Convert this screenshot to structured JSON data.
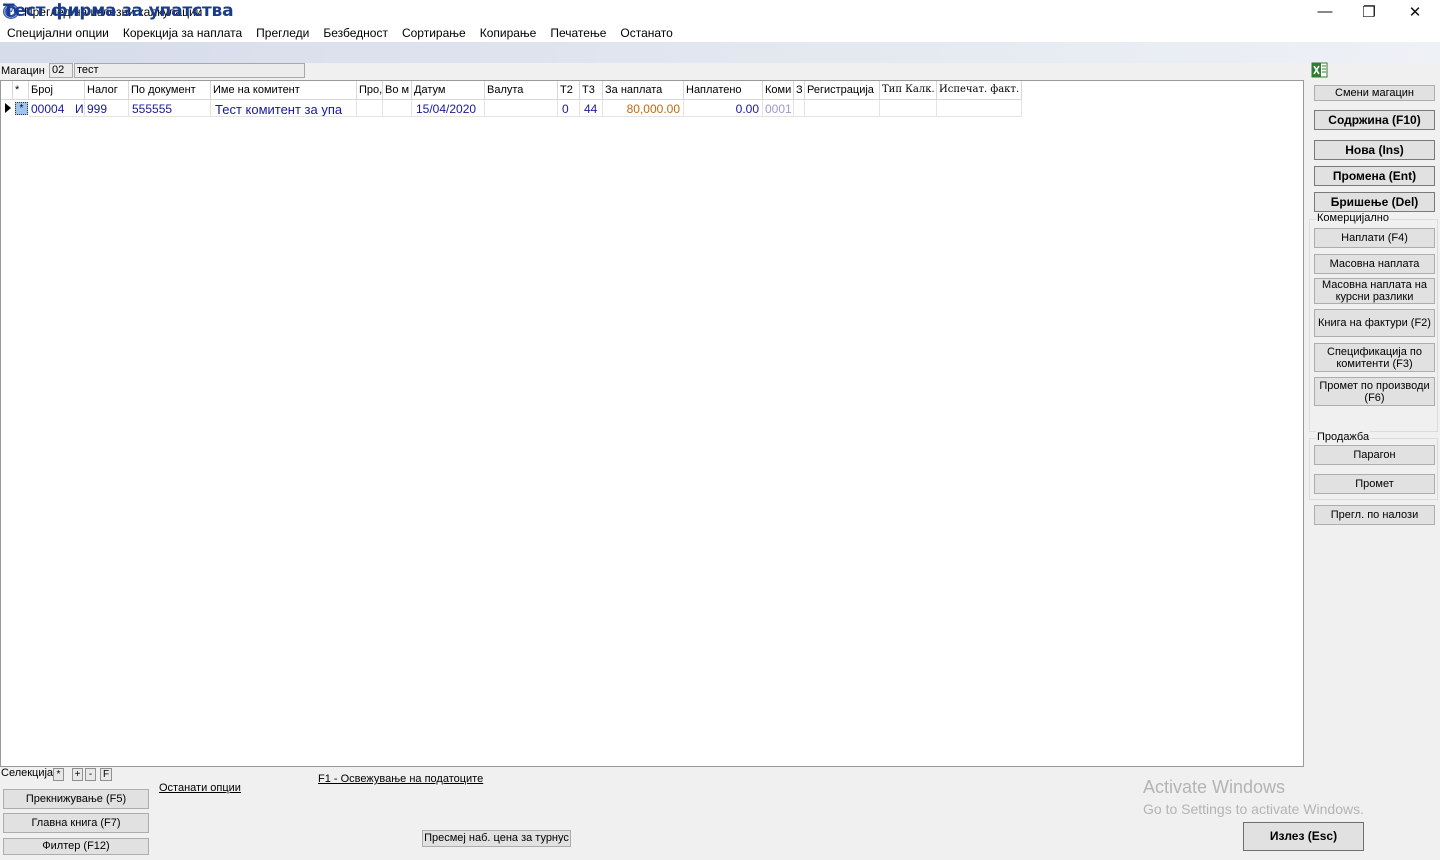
{
  "window": {
    "title": "Преглед на излезни калкулации",
    "minimize": "—",
    "restore": "❐",
    "close": "✕",
    "app_icon": "app-logo-icon",
    "app_icon_text": "ЕЛ"
  },
  "menu": [
    "Специјални опции",
    "Корекција за наплата",
    "Прегледи",
    "Безбедност",
    "Сортирање",
    "Копирање",
    "Печатење",
    "Останато"
  ],
  "company": {
    "title": "Тест фирма за упатства"
  },
  "magacin": {
    "label": "Магацин",
    "code": "02",
    "name": "тест"
  },
  "grid": {
    "headers": [
      "*",
      "Број",
      "Налог",
      "По документ",
      "Име на комитент",
      "Про,",
      "Во м",
      "Датум",
      "Валута",
      "Т2",
      "Т3",
      "За наплата",
      "Наплатено",
      "Коми",
      "З",
      "Регистрација",
      "Тип Калк.",
      "Испечат. факт."
    ],
    "rows": [
      {
        "check": "*",
        "broj": "00004",
        "tip": "И",
        "nalog": "999",
        "po_dokument": "555555",
        "ime_komitent": "Тест комитент за упа",
        "pro": "",
        "vo_m": "",
        "datum": "15/04/2020",
        "valuta": "",
        "t2": "0",
        "t3": "44",
        "za_naplata": "80,000.00",
        "naplateno": "0.00",
        "komi": "0001",
        "z": "",
        "registracija": "",
        "tip_kalk": "",
        "ispechat": ""
      }
    ],
    "colors": {
      "row_text": "#1a1a9a",
      "za_naplata": "#c06a10",
      "komi": "#9a9ad0"
    }
  },
  "right_panel": {
    "excel_icon": "excel-export-icon",
    "smeni_magacin": "Смени магацин",
    "sodrzina": "Содржина (F10)",
    "nova": "Нова (Ins)",
    "promena": "Промена (Ent)",
    "brisenje": "Бришење (Del)",
    "komercijalno_label": "Комерцијално",
    "naplati": "Наплати (F4)",
    "masovna_naplata": "Масовна наплата",
    "masovna_naplata_kursni": "Масовна наплата на курсни разлики",
    "kniga_faktury": "Книга на фактури (F2)",
    "specifikacija": "Спецификација по комитенти (F3)",
    "promet_proizvodi": "Промет по производи (F6)",
    "prodazba_label": "Продажба",
    "paragon": "Парагон",
    "promet": "Промет",
    "pregl_nalozi": "Прегл. по налози"
  },
  "bottom": {
    "selekcija_label": "Селекција:",
    "sel_star": "*",
    "sel_plus": "+",
    "sel_minus": "-",
    "sel_f": "F",
    "ostanati_opcii": "Останати опции",
    "f1_refresh": "F1 - Освежување на податоците",
    "prekniziuvanje": "Прекнижување (F5)",
    "glavna_kniga": "Главна книга (F7)",
    "filter": "Филтер (F12)",
    "presmej": "Пресмеј наб. цена за турнус",
    "izlez": "Излез (Esc)"
  },
  "watermark": {
    "title": "Activate Windows",
    "subtitle": "Go to Settings to activate Windows."
  }
}
